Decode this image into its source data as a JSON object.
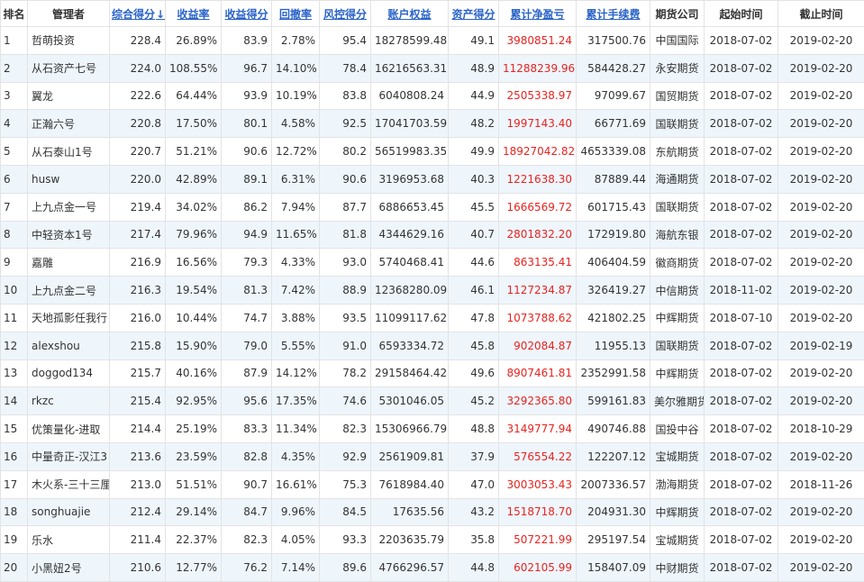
{
  "table": {
    "headers": [
      {
        "label": "排名",
        "link": false
      },
      {
        "label": "管理者",
        "link": false
      },
      {
        "label": "综合得分",
        "link": true,
        "sorted": true,
        "sort_glyph": "↓"
      },
      {
        "label": "收益率",
        "link": true
      },
      {
        "label": "收益得分",
        "link": true
      },
      {
        "label": "回撤率",
        "link": true
      },
      {
        "label": "风控得分",
        "link": true
      },
      {
        "label": "账户权益",
        "link": true
      },
      {
        "label": "资产得分",
        "link": true
      },
      {
        "label": "累计净盈亏",
        "link": true
      },
      {
        "label": "累计手续费",
        "link": true
      },
      {
        "label": "期货公司",
        "link": false
      },
      {
        "label": "起始时间",
        "link": false
      },
      {
        "label": "截止时间",
        "link": false
      }
    ],
    "rows": [
      [
        "1",
        "哲萌投资",
        "228.4",
        "26.89%",
        "83.9",
        "2.78%",
        "95.4",
        "18278599.48",
        "49.1",
        "3980851.24",
        "317500.76",
        "中国国际",
        "2018-07-02",
        "2019-02-20"
      ],
      [
        "2",
        "从石资产七号",
        "224.0",
        "108.55%",
        "96.7",
        "14.10%",
        "78.4",
        "16216563.31",
        "48.9",
        "11288239.96",
        "584428.27",
        "永安期货",
        "2018-07-02",
        "2019-02-20"
      ],
      [
        "3",
        "翼龙",
        "222.6",
        "64.44%",
        "93.9",
        "10.19%",
        "83.8",
        "6040808.24",
        "44.9",
        "2505338.97",
        "97099.67",
        "国贸期货",
        "2018-07-02",
        "2019-02-20"
      ],
      [
        "4",
        "正瀚六号",
        "220.8",
        "17.50%",
        "80.1",
        "4.58%",
        "92.5",
        "17041703.59",
        "48.2",
        "1997143.40",
        "66771.69",
        "国联期货",
        "2018-07-02",
        "2019-02-20"
      ],
      [
        "5",
        "从石泰山1号",
        "220.7",
        "51.21%",
        "90.6",
        "12.72%",
        "80.2",
        "56519983.35",
        "49.9",
        "18927042.82",
        "4653339.08",
        "东航期货",
        "2018-07-02",
        "2019-02-20"
      ],
      [
        "6",
        "husw",
        "220.0",
        "42.89%",
        "89.1",
        "6.31%",
        "90.6",
        "3196953.68",
        "40.3",
        "1221638.30",
        "87889.44",
        "海通期货",
        "2018-07-02",
        "2019-02-20"
      ],
      [
        "7",
        "上九点金一号",
        "219.4",
        "34.02%",
        "86.2",
        "7.94%",
        "87.7",
        "6886653.45",
        "45.5",
        "1666569.72",
        "601715.43",
        "国联期货",
        "2018-07-02",
        "2019-02-20"
      ],
      [
        "8",
        "中轻资本1号",
        "217.4",
        "79.96%",
        "94.9",
        "11.65%",
        "81.8",
        "4344629.16",
        "40.7",
        "2801832.20",
        "172919.80",
        "海航东银",
        "2018-07-02",
        "2019-02-20"
      ],
      [
        "9",
        "嘉雕",
        "216.9",
        "16.56%",
        "79.3",
        "4.33%",
        "93.0",
        "5740468.41",
        "44.6",
        "863135.41",
        "406404.59",
        "徽商期货",
        "2018-07-02",
        "2019-02-20"
      ],
      [
        "10",
        "上九点金二号",
        "216.3",
        "19.54%",
        "81.3",
        "7.42%",
        "88.9",
        "12368280.09",
        "46.1",
        "1127234.87",
        "326419.27",
        "中信期货",
        "2018-11-02",
        "2019-02-20"
      ],
      [
        "11",
        "天地孤影任我行",
        "216.0",
        "10.44%",
        "74.7",
        "3.88%",
        "93.5",
        "11099117.62",
        "47.8",
        "1073788.62",
        "421802.25",
        "中辉期货",
        "2018-07-10",
        "2019-02-20"
      ],
      [
        "12",
        "alexshou",
        "215.8",
        "15.90%",
        "79.0",
        "5.55%",
        "91.0",
        "6593334.72",
        "45.8",
        "902084.87",
        "11955.13",
        "国联期货",
        "2018-07-02",
        "2019-02-19"
      ],
      [
        "13",
        "doggod134",
        "215.7",
        "40.16%",
        "87.9",
        "14.12%",
        "78.2",
        "29158464.42",
        "49.6",
        "8907461.81",
        "2352991.58",
        "中辉期货",
        "2018-07-02",
        "2019-02-20"
      ],
      [
        "14",
        "rkzc",
        "215.4",
        "92.95%",
        "95.6",
        "17.35%",
        "74.6",
        "5301046.05",
        "45.2",
        "3292365.80",
        "599161.83",
        "美尔雅期货",
        "2018-07-02",
        "2019-02-20"
      ],
      [
        "15",
        "优策量化-进取",
        "214.4",
        "25.19%",
        "83.3",
        "11.34%",
        "82.3",
        "15306966.79",
        "48.8",
        "3149777.94",
        "490746.88",
        "国投中谷",
        "2018-07-02",
        "2018-10-29"
      ],
      [
        "16",
        "中量奇正-汉江3",
        "213.6",
        "23.59%",
        "82.8",
        "4.35%",
        "92.9",
        "2561909.81",
        "37.9",
        "576554.22",
        "122207.12",
        "宝城期货",
        "2018-07-02",
        "2019-02-20"
      ],
      [
        "17",
        "木火系-三十三厘",
        "213.0",
        "51.51%",
        "90.7",
        "16.61%",
        "75.3",
        "7618984.40",
        "47.0",
        "3003053.43",
        "2007336.57",
        "渤海期货",
        "2018-07-02",
        "2018-11-26"
      ],
      [
        "18",
        "songhuajie",
        "212.4",
        "29.14%",
        "84.7",
        "9.96%",
        "84.5",
        "17635.56",
        "43.2",
        "1518718.70",
        "204931.30",
        "中辉期货",
        "2018-07-02",
        "2019-02-20"
      ],
      [
        "19",
        "乐水",
        "211.4",
        "22.37%",
        "82.3",
        "4.05%",
        "93.3",
        "2203635.79",
        "35.8",
        "507221.99",
        "295197.54",
        "宝城期货",
        "2018-07-02",
        "2019-02-20"
      ],
      [
        "20",
        "小黑妞2号",
        "210.6",
        "12.77%",
        "76.2",
        "7.14%",
        "89.6",
        "4766296.57",
        "44.8",
        "602105.99",
        "158407.09",
        "中财期货",
        "2018-07-02",
        "2019-02-20"
      ]
    ]
  },
  "colors": {
    "link": "#2a63c9",
    "profit": "#e8231f",
    "stripe": "#eef6fc",
    "border": "#e3e3e3"
  }
}
